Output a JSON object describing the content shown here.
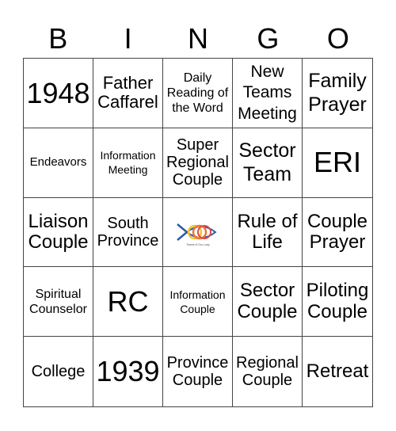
{
  "header": [
    "B",
    "I",
    "N",
    "G",
    "O"
  ],
  "cells": [
    "1948",
    "Father Caffarel",
    "Daily Reading of the Word",
    "New Teams Meeting",
    "Family Prayer",
    "Endeavors",
    "Information Meeting",
    "Super Regional Couple",
    "Sector Team",
    "ERI",
    "Liaison Couple",
    "South Province",
    "",
    "Rule of Life",
    "Couple Prayer",
    "Spiritual Counselor",
    "RC",
    "Information Couple",
    "Sector Couple",
    "Piloting Couple",
    "College",
    "1939",
    "Province Couple",
    "Regional Couple",
    "Retreat"
  ],
  "free_space": {
    "icon": "teams-of-our-lady-fish-logo-icon",
    "caption": "Teams of Our Lady"
  },
  "colors": {
    "fish_blue": "#2b5ca8",
    "ring_yellow": "#f4c430",
    "ring_orange": "#e8763a",
    "ring_red": "#e04848"
  }
}
